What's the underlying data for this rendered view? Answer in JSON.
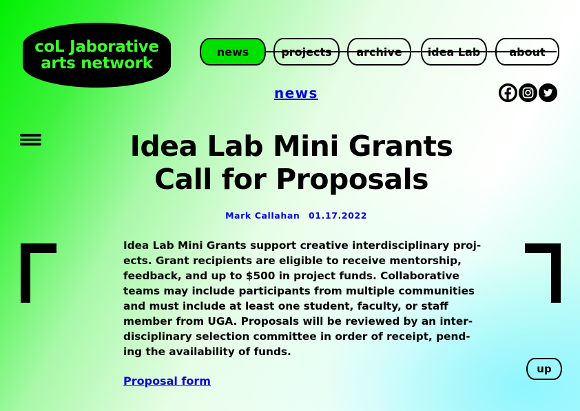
{
  "logo": {
    "line1": "coL Jaborative",
    "line2": "arts network"
  },
  "nav": {
    "items": [
      {
        "label": "news",
        "active": true
      },
      {
        "label": "projects"
      },
      {
        "label": "archive"
      },
      {
        "label": "idea Lab"
      },
      {
        "label": "about"
      }
    ]
  },
  "section": {
    "label": "news"
  },
  "social": {
    "icons": [
      "facebook-icon",
      "instagram-icon",
      "twitter-icon"
    ]
  },
  "article": {
    "title_line1": "Idea Lab Mini Grants",
    "title_line2": "Call for Proposals",
    "author": "Mark Callahan",
    "date": "01.17.2022",
    "body_lines": [
      "Idea Lab Mini Grants support creative interdisciplinary proj-",
      "ects. Grant recipients are eligible to receive mentorship,",
      "feedback, and up to $500 in project funds. Collaborative",
      "teams may include participants from multiple communities",
      "and must include at least one student, faculty, or staff",
      "member from UGA. Proposals will be reviewed by an inter-",
      "disciplinary selection committee in order of receipt, pend-",
      "ing the availability of funds."
    ],
    "link_label": "Proposal form"
  },
  "controls": {
    "up_label": "up",
    "menu_icon": "hamburger-menu-icon"
  },
  "colors": {
    "accent_green": "#00e000",
    "logo_text": "#3cff2a",
    "link_blue": "#0a00e6"
  }
}
